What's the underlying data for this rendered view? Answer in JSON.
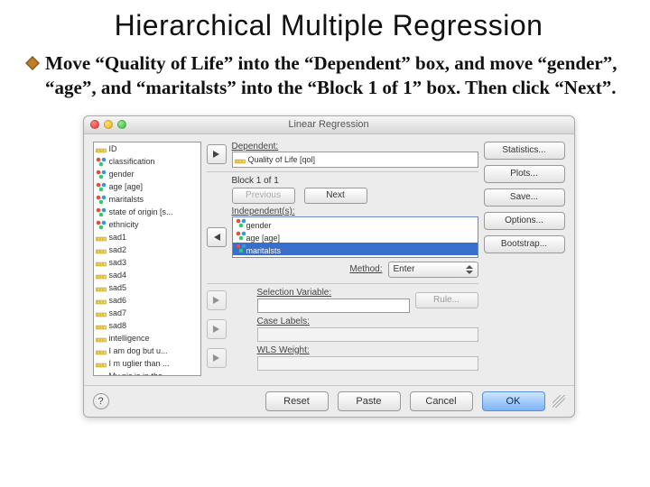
{
  "slide": {
    "title": "Hierarchical Multiple Regression",
    "body": "Move “Quality of Life” into the “Dependent” box, and move “gender”, “age”, and “maritalsts” into the “Block 1 of 1” box. Then click “Next”."
  },
  "dialog": {
    "title": "Linear Regression",
    "variables": [
      {
        "label": "ID",
        "type": "scale"
      },
      {
        "label": "classification",
        "type": "nominal"
      },
      {
        "label": "gender",
        "type": "nominal"
      },
      {
        "label": "age [age]",
        "type": "nominal"
      },
      {
        "label": "maritalsts",
        "type": "nominal"
      },
      {
        "label": "state of origin [s...",
        "type": "nominal"
      },
      {
        "label": "ethnicity",
        "type": "nominal"
      },
      {
        "label": "sad1",
        "type": "scale"
      },
      {
        "label": "sad2",
        "type": "scale"
      },
      {
        "label": "sad3",
        "type": "scale"
      },
      {
        "label": "sad4",
        "type": "scale"
      },
      {
        "label": "sad5",
        "type": "scale"
      },
      {
        "label": "sad6",
        "type": "scale"
      },
      {
        "label": "sad7",
        "type": "scale"
      },
      {
        "label": "sad8",
        "type": "scale"
      },
      {
        "label": "intelligence",
        "type": "scale"
      },
      {
        "label": "I am dog but u...",
        "type": "scale"
      },
      {
        "label": "I m uglier than ...",
        "type": "scale"
      },
      {
        "label": "My pic is in the...",
        "type": "scale"
      }
    ],
    "dependent": {
      "label": "Dependent:",
      "value": "Quality of Life [qol]"
    },
    "block": {
      "label": "Block 1 of 1",
      "prev": "Previous",
      "next": "Next",
      "indep_label": "Independent(s):",
      "items": [
        {
          "label": "gender",
          "type": "nominal",
          "selected": false
        },
        {
          "label": "age [age]",
          "type": "nominal",
          "selected": false
        },
        {
          "label": "maritalsts",
          "type": "nominal",
          "selected": true
        }
      ]
    },
    "method": {
      "label": "Method:",
      "value": "Enter"
    },
    "selection": {
      "label": "Selection Variable:",
      "rule": "Rule..."
    },
    "case": {
      "label": "Case Labels:"
    },
    "wls": {
      "label": "WLS Weight:"
    },
    "side_buttons": {
      "statistics": "Statistics...",
      "plots": "Plots...",
      "save": "Save...",
      "options": "Options...",
      "bootstrap": "Bootstrap..."
    },
    "footer": {
      "help": "?",
      "reset": "Reset",
      "paste": "Paste",
      "cancel": "Cancel",
      "ok": "OK"
    }
  }
}
